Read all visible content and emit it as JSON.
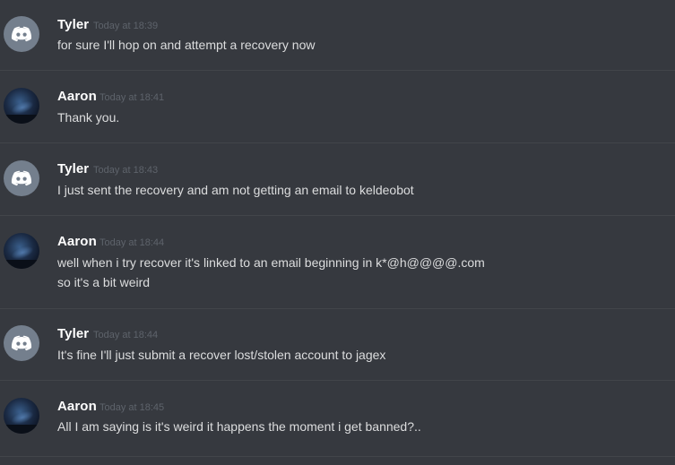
{
  "messages": [
    {
      "author": "Tyler",
      "timestamp": "Today at 18:39",
      "avatar": "discord-logo-icon",
      "lines": [
        "for sure I'll hop on and attempt a recovery now"
      ]
    },
    {
      "author": "Aaron",
      "timestamp": "Today at 18:41",
      "avatar": "night-sky-photo",
      "lines": [
        "Thank you."
      ]
    },
    {
      "author": "Tyler",
      "timestamp": "Today at 18:43",
      "avatar": "discord-logo-icon",
      "lines": [
        "I just sent the recovery and am not getting an email to keldeobot"
      ]
    },
    {
      "author": "Aaron",
      "timestamp": "Today at 18:44",
      "avatar": "night-sky-photo",
      "lines": [
        "well when i try recover it's linked to an email beginning in k*@h@@@@.com",
        "so it's a bit weird"
      ]
    },
    {
      "author": "Tyler",
      "timestamp": "Today at 18:44",
      "avatar": "discord-logo-icon",
      "lines": [
        "It's fine I'll just submit a recover lost/stolen account to jagex"
      ]
    },
    {
      "author": "Aaron",
      "timestamp": "Today at 18:45",
      "avatar": "night-sky-photo",
      "lines": [
        "All I am saying is it's weird it happens the moment i get banned?.."
      ]
    }
  ],
  "colors": {
    "background": "#36393f",
    "divider": "#42454a",
    "author": "#ffffff",
    "timestamp": "#5e636b",
    "message_text": "#dcddde",
    "discord_avatar_bg": "#747f8d"
  }
}
